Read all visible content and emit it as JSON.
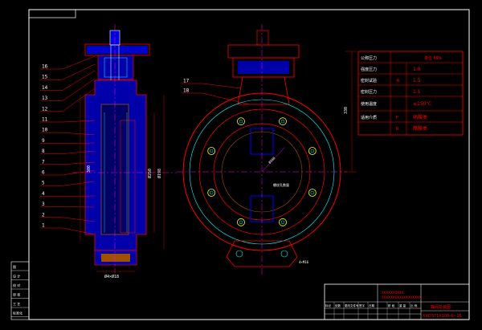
{
  "colors": {
    "background": "#000000",
    "frame": "#ffffff",
    "outline_red": "#ff0000",
    "body_blue": "#0000ff",
    "centerline_magenta": "#ff00ff",
    "annotation_cyan": "#00ffff",
    "text_white": "#ffffff",
    "circle_yellow": "#ffff00",
    "hatch_brown": "#a05000",
    "hatch_green": "#00ff00"
  },
  "balloons": {
    "left": [
      "16",
      "15",
      "14",
      "13",
      "12",
      "11",
      "10",
      "9",
      "8",
      "7",
      "6",
      "5",
      "4",
      "3",
      "2",
      "1"
    ],
    "right": [
      "17",
      "18"
    ]
  },
  "specs_table": {
    "header_left": "公称压力",
    "header_right": "单位 MPa",
    "rows": [
      {
        "label": "强度压力",
        "mid": "",
        "value": "1.0"
      },
      {
        "label": "密封试验",
        "mid": "水",
        "value": "1.5"
      },
      {
        "label": "密封压力",
        "mid": "",
        "value": "1.1"
      },
      {
        "label": "使用温度",
        "mid": "",
        "value": "≤150℃"
      },
      {
        "label": "适用介质",
        "mid": "P",
        "value": "硝酸类"
      },
      {
        "label": "",
        "mid": "R",
        "value": "醋酸类"
      }
    ]
  },
  "left_strip": {
    "labels": [
      "图",
      "设 计",
      "校 对",
      "审 核",
      "工 艺",
      "标准化"
    ]
  },
  "title_block": {
    "company_line1": "XXXXXXXXXX",
    "company_line2": "XXXXXXXXXXXXXXXXXX",
    "drawing_name": "蝶阀总装图",
    "drawing_number": "XXD371X10R-6~25",
    "row_labels": [
      "标记",
      "处数",
      "更改文件号",
      "签字",
      "日期"
    ],
    "stage_labels": [
      "阶 段",
      "重 量",
      "比 例"
    ]
  },
  "dimensions": {
    "right_height": "330",
    "left_height1": "300",
    "left_height2": "Ø250",
    "left_height3": "Ø198",
    "bottom_width": "Ø4×Ø18",
    "slot_note": "螺纹孔数量",
    "dia_note": "Ø200",
    "lower_note": "4×M16"
  }
}
